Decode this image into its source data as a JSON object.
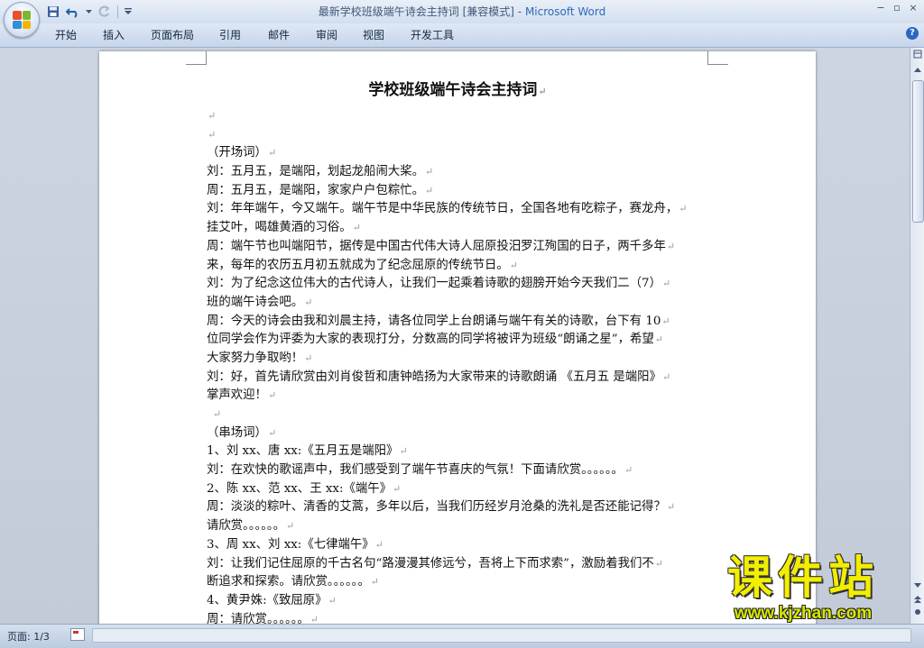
{
  "window": {
    "title_doc": "最新学校班级端午诗会主持词 [兼容模式]",
    "title_sep": " - ",
    "title_app": "Microsoft Word",
    "controls": {
      "minimize": "−",
      "restore": "▫",
      "close": "×"
    }
  },
  "quick_access": {
    "save_icon": "save-icon",
    "undo_icon": "undo-icon",
    "redo_icon": "redo-icon",
    "customize_icon": "customize-icon"
  },
  "ribbon": {
    "tabs": [
      "开始",
      "插入",
      "页面布局",
      "引用",
      "邮件",
      "审阅",
      "视图",
      "开发工具"
    ],
    "help_label": "?"
  },
  "document": {
    "title": "学校班级端午诗会主持词",
    "lines": [
      "",
      "",
      "（开场词）",
      "刘：五月五，是端阳，划起龙船闹大桨。",
      "周：五月五，是端阳，家家户户包粽忙。",
      "刘：年年端午，今又端午。端午节是中华民族的传统节日，全国各地有吃粽子，赛龙舟，",
      "挂艾叶，喝雄黄酒的习俗。",
      "周：端午节也叫端阳节，据传是中国古代伟大诗人屈原投汨罗江殉国的日子，两千多年",
      "来，每年的农历五月初五就成为了纪念屈原的传统节日。",
      "刘：为了纪念这位伟大的古代诗人，让我们一起乘着诗歌的翅膀开始今天我们二（7）",
      "班的端午诗会吧。",
      "周：今天的诗会由我和刘晨主持，请各位同学上台朗诵与端午有关的诗歌，台下有 10",
      "位同学会作为评委为大家的表现打分，分数高的同学将被评为班级“朗诵之星”，希望",
      "大家努力争取哟！",
      "刘：好，首先请欣赏由刘肖俊哲和唐钟皓扬为大家带来的诗歌朗诵 《五月五 是端阳》",
      "掌声欢迎！",
      "",
      "（串场词）",
      "1、刘 xx、唐 xx:《五月五是端阳》",
      "刘：在欢快的歌谣声中，我们感受到了端午节喜庆的气氛！下面请欣赏。。。。。。",
      "2、陈 xx、范 xx、王 xx:《端午》",
      "周：淡淡的粽叶、清香的艾蒿，多年以后，当我们历经岁月沧桑的洗礼是否还能记得？",
      "请欣赏。。。。。。",
      "3、周 xx、刘 xx:《七律端午》",
      "刘：让我们记住屈原的千古名句“路漫漫其修远兮，吾将上下而求索”，激励着我们不",
      "断追求和探索。请欣赏。。。。。。",
      "4、黄尹姝:《致屈原》",
      "周：请欣赏。。。。。。"
    ],
    "paragraph_mark": "↵"
  },
  "status": {
    "page_label": "页面: 1/3"
  },
  "watermark": {
    "main": "课件站",
    "url": "www.kjzhan.com"
  },
  "colors": {
    "title_app": "#2d6bb5",
    "watermark": "#f2ee00",
    "workspace": "#c7cfdb"
  }
}
